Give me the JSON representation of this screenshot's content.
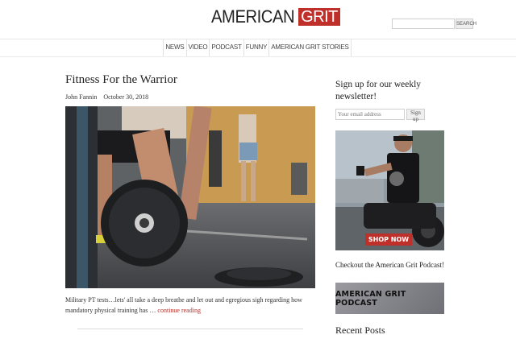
{
  "header": {
    "logo_part1": "AMERICAN",
    "logo_part2": "GRIT",
    "search_button": "SEARCH",
    "search_placeholder": ""
  },
  "nav": {
    "items": [
      "NEWS",
      "VIDEO",
      "PODCAST",
      "FUNNY",
      "AMERICAN GRIT STORIES"
    ]
  },
  "post": {
    "title": "Fitness For the Warrior",
    "author": "John Fannin",
    "date": "October 30, 2018",
    "excerpt": "Military PT tests…lets' all take a deep breathe and let out and egregious sigh regarding how mandatory physical training has …",
    "continue_label": "continue reading"
  },
  "sidebar": {
    "newsletter_title": "Sign up for our weekly newsletter!",
    "email_placeholder": "Your email address",
    "signup_button": "Sign up",
    "ad_button": "SHOP NOW",
    "podcast_heading": "Checkout the American Grit Podcast!",
    "podcast_banner": "AMERICAN GRIT PODCAST",
    "recent_posts_title": "Recent Posts"
  },
  "colors": {
    "brand_red": "#c0302a",
    "link_red": "#b12d27"
  }
}
